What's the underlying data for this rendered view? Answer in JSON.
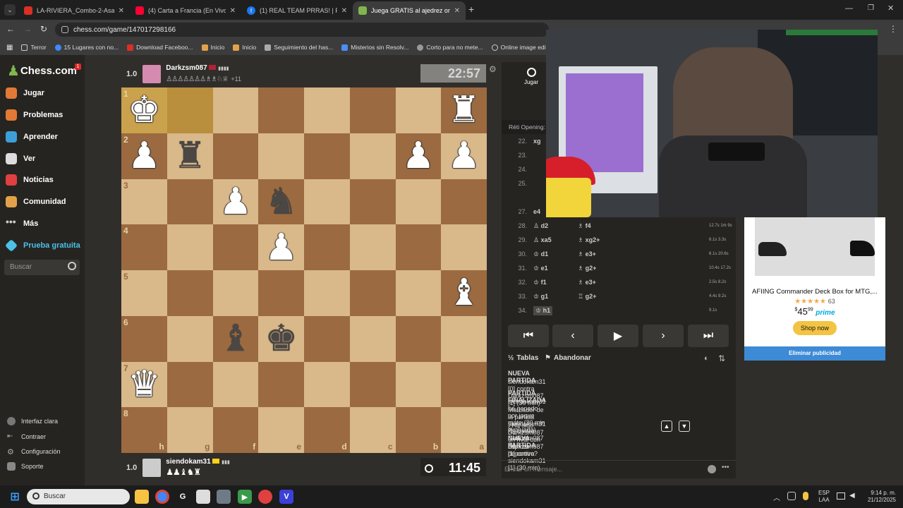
{
  "tabs": [
    {
      "label": "LA-RIVIERA_Combo-2-Asados",
      "favicon_color": "#d93025"
    },
    {
      "label": "(4) Carta a Francia (En Vivo) - Yo",
      "favicon_color": "#ff0033"
    },
    {
      "label": "(1) REAL TEAM PRRAS! | Facebo",
      "favicon_color": "#1877f2"
    },
    {
      "label": "Juega GRATIS al ajedrez online",
      "favicon_color": "#81b64c"
    }
  ],
  "address": {
    "url": "chess.com/game/147017298166"
  },
  "bookmarks": [
    "Terror",
    "15 Lugares con no...",
    "Download Faceboo...",
    "Inicio",
    "Inicio",
    "Seguimiento del has...",
    "Misterios sin Resolv...",
    "Corto para no mete...",
    "Online image editor"
  ],
  "sidebar": {
    "logo": "Chess.com",
    "badge": "1",
    "items": [
      {
        "label": "Jugar",
        "icon": "pawn-hand-icon",
        "color": "#e27a36"
      },
      {
        "label": "Problemas",
        "icon": "puzzle-icon",
        "color": "#e27a36"
      },
      {
        "label": "Aprender",
        "icon": "learn-icon",
        "color": "#3d9fd9"
      },
      {
        "label": "Ver",
        "icon": "binoculars-icon",
        "color": "#dddddd"
      },
      {
        "label": "Noticias",
        "icon": "news-icon",
        "color": "#e04040"
      },
      {
        "label": "Comunidad",
        "icon": "community-icon",
        "color": "#e2a24a"
      },
      {
        "label": "Más",
        "icon": "more-icon",
        "color": "#cccccc"
      },
      {
        "label": "Prueba gratuita",
        "icon": "diamond-icon",
        "color": "#4cc0e8"
      }
    ],
    "search_placeholder": "Buscar",
    "bottom": [
      "Interfaz clara",
      "Contraer",
      "Configuración",
      "Soporte"
    ]
  },
  "top_player": {
    "score": "1.0",
    "name": "Darkzsm087",
    "captured": "♙♙♙♙♙♙♙♗♗♘♕",
    "advantage": "+11",
    "clock": "22:57"
  },
  "bottom_player": {
    "score": "1.0",
    "name": "siendokam31",
    "captured": "♟♟♝♞♜",
    "clock": "11:45"
  },
  "board": {
    "ranks": [
      "1",
      "2",
      "3",
      "4",
      "5",
      "6",
      "7",
      "8"
    ],
    "files": [
      "h",
      "g",
      "f",
      "e",
      "d",
      "c",
      "b",
      "a"
    ],
    "pieces": [
      {
        "sq": "0-0",
        "glyph": "♚",
        "color": "w"
      },
      {
        "sq": "0-7",
        "glyph": "♜",
        "color": "w"
      },
      {
        "sq": "1-0",
        "glyph": "♟",
        "color": "w"
      },
      {
        "sq": "1-1",
        "glyph": "♜",
        "color": "b"
      },
      {
        "sq": "1-6",
        "glyph": "♟",
        "color": "w"
      },
      {
        "sq": "1-7",
        "glyph": "♟",
        "color": "w"
      },
      {
        "sq": "2-2",
        "glyph": "♟",
        "color": "w"
      },
      {
        "sq": "2-3",
        "glyph": "♞",
        "color": "b"
      },
      {
        "sq": "3-3",
        "glyph": "♟",
        "color": "w"
      },
      {
        "sq": "4-7",
        "glyph": "♝",
        "color": "w"
      },
      {
        "sq": "5-2",
        "glyph": "♝",
        "color": "b"
      },
      {
        "sq": "5-3",
        "glyph": "♚",
        "color": "b"
      },
      {
        "sq": "6-0",
        "glyph": "♛",
        "color": "w"
      }
    ]
  },
  "panel": {
    "play_tab": "Jugar",
    "opening": "Réti Opening:",
    "moves": [
      {
        "n": "22.",
        "w": "xg",
        "b": "",
        "t": ""
      },
      {
        "n": "23.",
        "w": "",
        "b": "",
        "t": ""
      },
      {
        "n": "24.",
        "w": "",
        "b": "",
        "t": ""
      },
      {
        "n": "25.",
        "w": "",
        "b": "",
        "t": ""
      },
      {
        "n": "27.",
        "w": "e4",
        "b": "",
        "t": ""
      },
      {
        "n": "28.",
        "w": "♙ d2",
        "b": "♗ f4",
        "t": "12.7s 1m 9s"
      },
      {
        "n": "29.",
        "w": "♙ xa5",
        "b": "♗ xg2+",
        "t": "6.1s 3.3s"
      },
      {
        "n": "30.",
        "w": "♔ d1",
        "b": "♗ e3+",
        "t": "6.1s 20.6s"
      },
      {
        "n": "31.",
        "w": "♔ e1",
        "b": "♗ g2+",
        "t": "10.4s 17.2s"
      },
      {
        "n": "32.",
        "w": "♔ f1",
        "b": "♗ e3+",
        "t": "2.5s 8.2s"
      },
      {
        "n": "33.",
        "w": "♔ g1",
        "b": "♖ g2+",
        "t": "4.4s 9.2s"
      },
      {
        "n": "34.",
        "w": "♔ h1",
        "b": "",
        "t": "9.1s"
      }
    ],
    "draw": "Tablas",
    "resign": "Abandonar",
    "log": [
      {
        "kind": "head",
        "text": "NUEVA PARTIDA"
      },
      {
        "kind": "line",
        "text": "siendokam31 [0] contra Darkzsm087 [1] (30 min)"
      },
      {
        "kind": "head",
        "text": "PARTIDA FINALIZADA"
      },
      {
        "kind": "line",
        "text": "siendokam31 ha ganado por jaque mate (30 min evaluada)"
      },
      {
        "kind": "line",
        "text": "Marcador de la partida siendokam31 [1] contra Darkzsm087 [1]"
      },
      {
        "kind": "q",
        "text": "¿Ha sido Darkzsm087 un rival con espíritu deportivo?"
      },
      {
        "kind": "head",
        "text": "NUEVA PARTIDA"
      },
      {
        "kind": "line",
        "text": "Darkzsm087 [1] contra siendokam31 [1] (30 min)"
      }
    ],
    "message_placeholder": "Enviar un mensaje..."
  },
  "ad": {
    "title": "AFIING Commander Deck Box for MTG,...",
    "stars": "★★★★★",
    "rating_count": "63",
    "price_whole": "45",
    "price_cents": "99",
    "prime": "prime",
    "cta": "Shop now",
    "remove": "Eliminar publicidad"
  },
  "taskbar": {
    "search": "Buscar",
    "lang1": "ESP",
    "lang2": "LAA",
    "time": "9:14 p. m.",
    "date": "21/12/2025"
  }
}
